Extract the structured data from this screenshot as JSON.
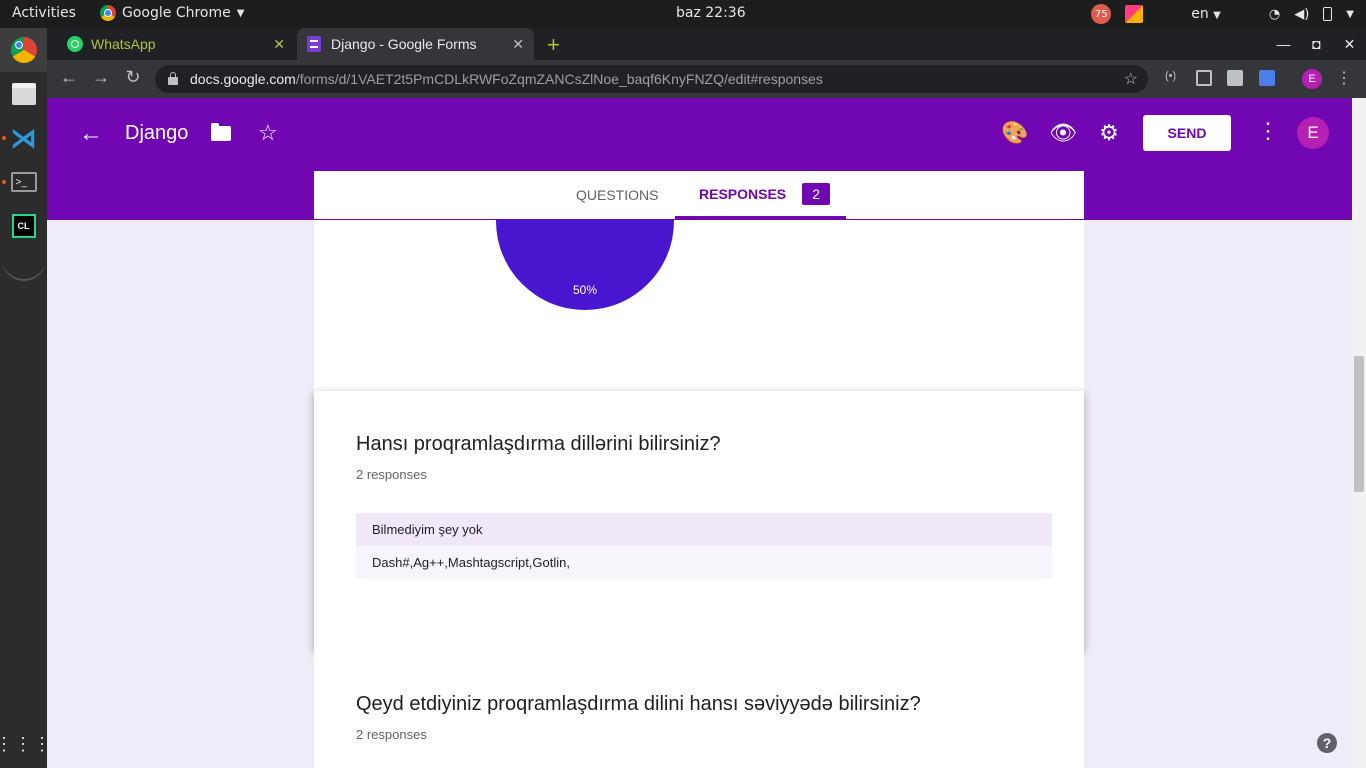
{
  "system_bar": {
    "activities": "Activities",
    "app_name": "Google Chrome",
    "clock": "baz 22:36",
    "notification_count": "75",
    "language": "en"
  },
  "browser": {
    "tabs": [
      {
        "label": "WhatsApp"
      },
      {
        "label": "Django - Google Forms"
      }
    ],
    "url_host": "docs.google.com",
    "url_path": "/forms/d/1VAET2t5PmCDLkRWFoZqmZANCsZlNoe_baqf6KnyFNZQ/edit#responses",
    "profile_initial": "E"
  },
  "form_header": {
    "title": "Django",
    "send_label": "SEND",
    "profile_initial": "E",
    "accent": "#7107b3"
  },
  "form_tabs": {
    "questions": "QUESTIONS",
    "responses": "RESPONSES",
    "responses_count": "2"
  },
  "pie": {
    "label": "50%",
    "color": "#4a15cf"
  },
  "question1": {
    "title": "Hansı proqramlaşdırma dillərini bilirsiniz?",
    "count": "2 responses",
    "answers": [
      "Bilmediyim şey yok",
      "Dash#,Ag++,Mashtagscript,Gotlin,"
    ]
  },
  "question2": {
    "title": "Qeyd etdiyiniz proqramlaşdırma dilini hansı səviyyədə bilirsiniz?",
    "count": "2 responses"
  },
  "help_label": "?"
}
